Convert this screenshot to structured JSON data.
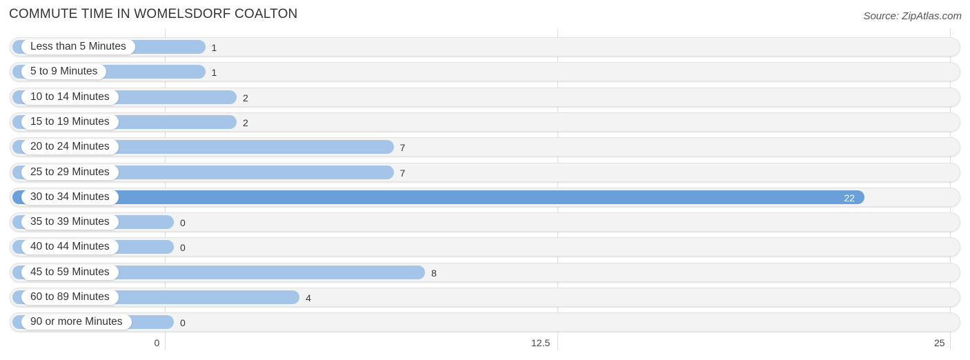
{
  "chart_data": {
    "type": "bar",
    "orientation": "horizontal",
    "title": "COMMUTE TIME IN WOMELSDORF COALTON",
    "source": "Source: ZipAtlas.com",
    "categories": [
      "Less than 5 Minutes",
      "5 to 9 Minutes",
      "10 to 14 Minutes",
      "15 to 19 Minutes",
      "20 to 24 Minutes",
      "25 to 29 Minutes",
      "30 to 34 Minutes",
      "35 to 39 Minutes",
      "40 to 44 Minutes",
      "45 to 59 Minutes",
      "60 to 89 Minutes",
      "90 or more Minutes"
    ],
    "values": [
      1,
      1,
      2,
      2,
      7,
      7,
      22,
      0,
      0,
      8,
      4,
      0
    ],
    "highlight_index": 6,
    "xlabel": "",
    "ylabel": "",
    "xlim": [
      0,
      25
    ],
    "xticks": [
      "0",
      "12.5",
      "25"
    ],
    "xtick_values": [
      0,
      12.5,
      25
    ],
    "grid": true,
    "colors": {
      "bar": "#a4c4e8",
      "highlight": "#6a9fd9",
      "track": "#f3f3f3"
    }
  }
}
